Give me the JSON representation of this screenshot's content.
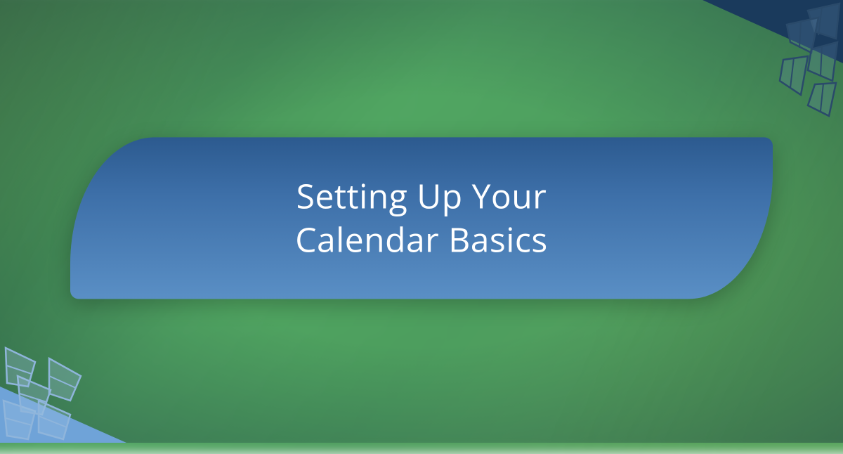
{
  "banner": {
    "title_line1": "Setting Up Your",
    "title_line2": "Calendar Basics"
  },
  "colors": {
    "banner_gradient_start": "#2c5a8f",
    "banner_gradient_end": "#5a8fc5",
    "corner_dark": "#1a3a5c",
    "corner_light": "#6fa3d8",
    "background_green": "#3a9050"
  }
}
